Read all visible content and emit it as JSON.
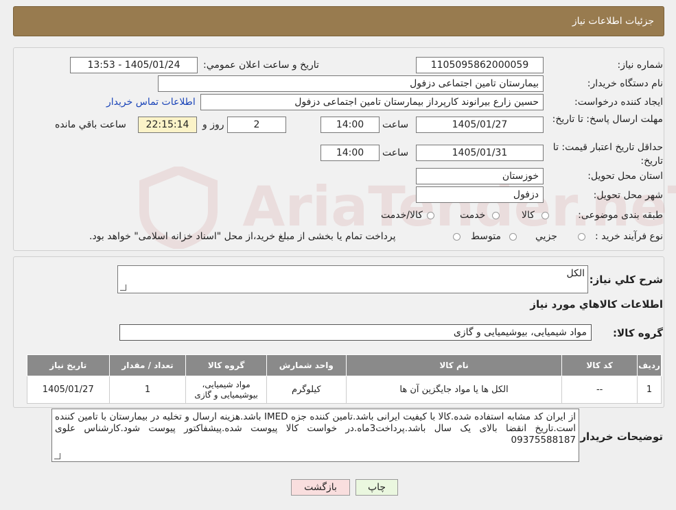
{
  "header": {
    "title": "جزئیات اطلاعات نیاز"
  },
  "form": {
    "need_number_label": "شماره نیاز:",
    "need_number": "1105095862000059",
    "announce_label": "تاريخ و ساعت اعلان عمومي:",
    "announce_value": "1405/01/24 - 13:53",
    "buyer_org_label": "نام دستگاه خريدار:",
    "buyer_org": "بیمارستان تامین اجتماعی دزفول",
    "requester_label": "ايجاد کننده درخواست:",
    "requester": "حسین زارع بیرانوند کارپرداز بیمارستان تامین اجتماعی دزفول",
    "contact_link": "اطلاعات تماس خريدار",
    "deadline_label": "مهلت ارسال پاسخ: تا تاريخ:",
    "deadline_date": "1405/01/27",
    "time_label": "ساعت",
    "deadline_time": "14:00",
    "days_value": "2",
    "days_label": "روز و",
    "remaining_time": "22:15:14",
    "remaining_label": "ساعت باقي مانده",
    "price_valid_label": "حداقل تاريخ اعتبار قيمت: تا تاريخ:",
    "price_valid_date": "1405/01/31",
    "price_valid_time": "14:00",
    "province_label": "استان محل تحويل:",
    "province": "خوزستان",
    "city_label": "شهر محل تحويل:",
    "city": "دزفول",
    "category_label": "طبقه بندی موضوعی:",
    "category_options": [
      "کالا",
      "خدمت",
      "کالا/خدمت"
    ],
    "process_label": "نوع فرآيند خريد :",
    "process_options": [
      "جزيي",
      "متوسط"
    ],
    "process_note": "پرداخت تمام يا بخشی از مبلغ خريد،از محل \"اسناد خزانه اسلامی\" خواهد بود."
  },
  "need": {
    "summary_label": "شرح كلي نياز:",
    "summary": "الکل",
    "goods_info_title": "اطلاعات كالاهاي مورد نياز",
    "goods_group_label": "گروه كالا:",
    "goods_group": "مواد شیمیایی، بیوشیمیایی و  گازی"
  },
  "table": {
    "headers": [
      "رديف",
      "كد كالا",
      "نام كالا",
      "واحد شمارش",
      "گروه كالا",
      "تعداد / مقدار",
      "تاريخ نياز"
    ],
    "rows": [
      {
        "row": "1",
        "code": "--",
        "name": "الکل ها یا مواد جایگزین آن ها",
        "unit": "کیلوگرم",
        "group": "مواد شیمیایی، بیوشیمیایی و گازی",
        "qty": "1",
        "date": "1405/01/27"
      }
    ]
  },
  "buyer_notes": {
    "label": "توضيحات خريدار:",
    "text": "از ایران کد مشابه استفاده شده.کالا با کیفیت ایرانی باشد.تامین کننده جزه IMED باشد.هزینه ارسال و تخلیه در بیمارستان با تامین کننده است.تاریخ انقضا بالای یک سال باشد.پرداخت3ماه.در خواست کالا پیوست شده.پیشفاکتور پیوست شود.کارشناس علوی 09375588187"
  },
  "buttons": {
    "print": "چاپ",
    "back": "بازگشت"
  },
  "watermark": "AriaTender.neT",
  "colors": {
    "header_bg": "#987b4f",
    "link": "#1a44b8",
    "table_header": "#8a8a8a",
    "print_btn": "#eaf7df",
    "back_btn": "#f9dede"
  }
}
